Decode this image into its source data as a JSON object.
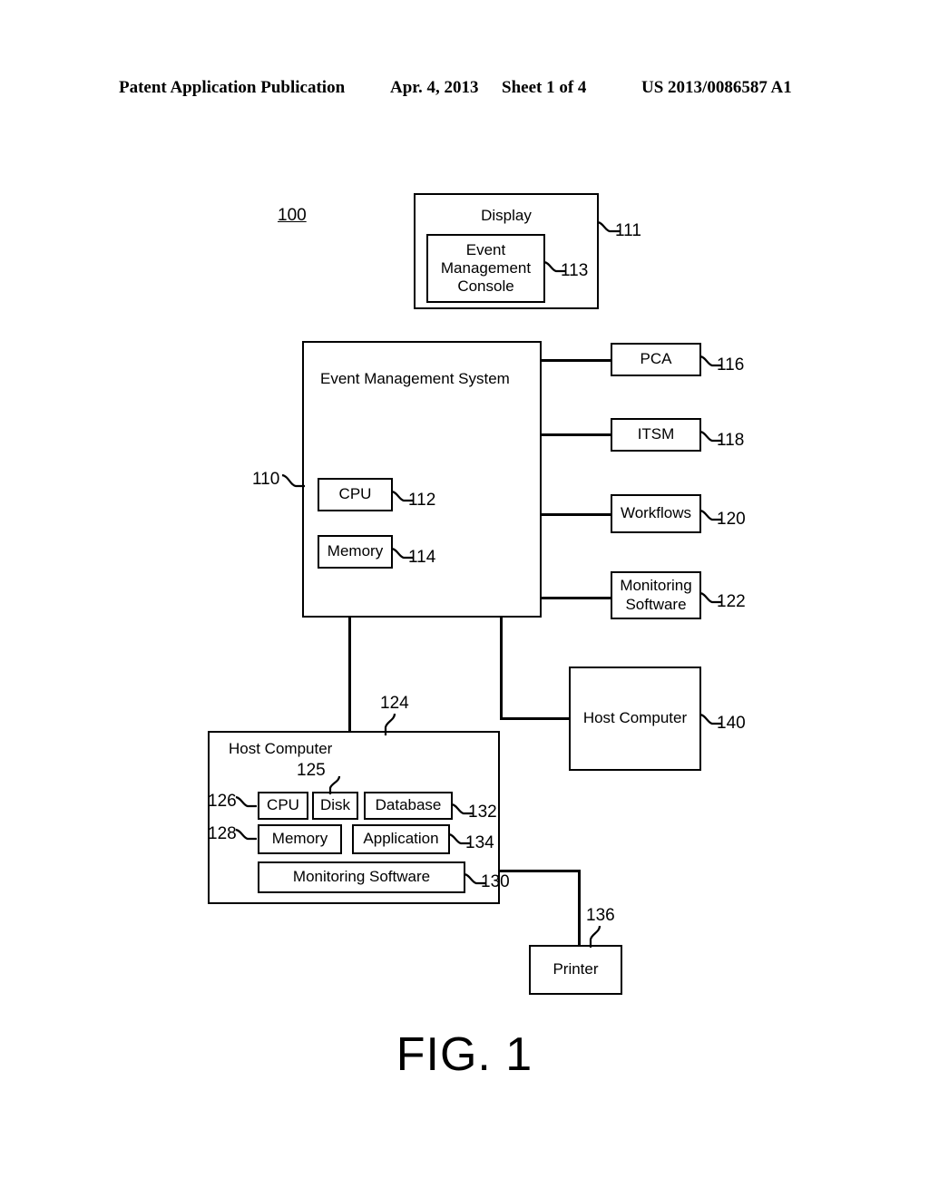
{
  "header": {
    "publication": "Patent Application Publication",
    "date": "Apr. 4, 2013",
    "sheet": "Sheet 1 of 4",
    "patent_number": "US 2013/0086587 A1"
  },
  "figure": {
    "caption": "FIG. 1",
    "system_ref": "100"
  },
  "blocks": {
    "display": {
      "label": "Display",
      "ref": "111"
    },
    "event_management_console": {
      "label_line1": "Event",
      "label_line2": "Management",
      "label_line3": "Console",
      "ref": "113"
    },
    "event_management_system": {
      "label": "Event Management System",
      "ref": "110"
    },
    "ems_cpu": {
      "label": "CPU",
      "ref": "112"
    },
    "ems_memory": {
      "label": "Memory",
      "ref": "114"
    },
    "pca": {
      "label": "PCA",
      "ref": "116"
    },
    "itsm": {
      "label": "ITSM",
      "ref": "118"
    },
    "workflows": {
      "label": "Workflows",
      "ref": "120"
    },
    "monitoring_software_ems": {
      "label_line1": "Monitoring",
      "label_line2": "Software",
      "ref": "122"
    },
    "host_computer_main": {
      "label": "Host Computer",
      "ref": "124"
    },
    "host_cpu": {
      "label": "CPU",
      "ref": "126"
    },
    "host_disk": {
      "label": "Disk",
      "ref": "125"
    },
    "host_database": {
      "label": "Database",
      "ref": "132"
    },
    "host_memory": {
      "label": "Memory",
      "ref": "128"
    },
    "host_application": {
      "label": "Application",
      "ref": "134"
    },
    "host_monitoring_software": {
      "label": "Monitoring Software",
      "ref": "130"
    },
    "host_computer_secondary": {
      "label": "Host Computer",
      "ref": "140"
    },
    "printer": {
      "label": "Printer",
      "ref": "136"
    }
  }
}
